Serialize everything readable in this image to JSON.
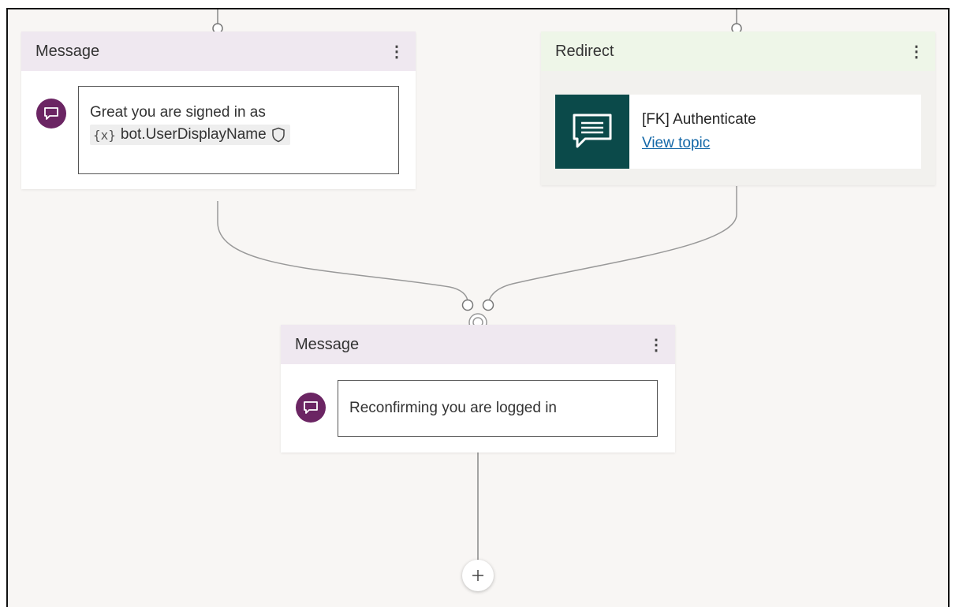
{
  "nodes": {
    "message1": {
      "title": "Message",
      "text": "Great you are signed in as",
      "variable": "bot.UserDisplayName",
      "variable_icon": "{x}"
    },
    "redirect": {
      "title": "Redirect",
      "topic_name": "[FK] Authenticate",
      "link": "View topic"
    },
    "message2": {
      "title": "Message",
      "text": "Reconfirming you are logged in"
    }
  },
  "icons": {
    "more": "more-vertical-icon",
    "chat": "chat-bubble-icon",
    "shield": "shield-icon",
    "add": "plus-icon"
  },
  "colors": {
    "avatar": "#6b2563",
    "topic_icon_bg": "#0b4a4a",
    "link": "#1468a8",
    "message_header": "#efe8f0",
    "redirect_header": "#eef6e8"
  }
}
